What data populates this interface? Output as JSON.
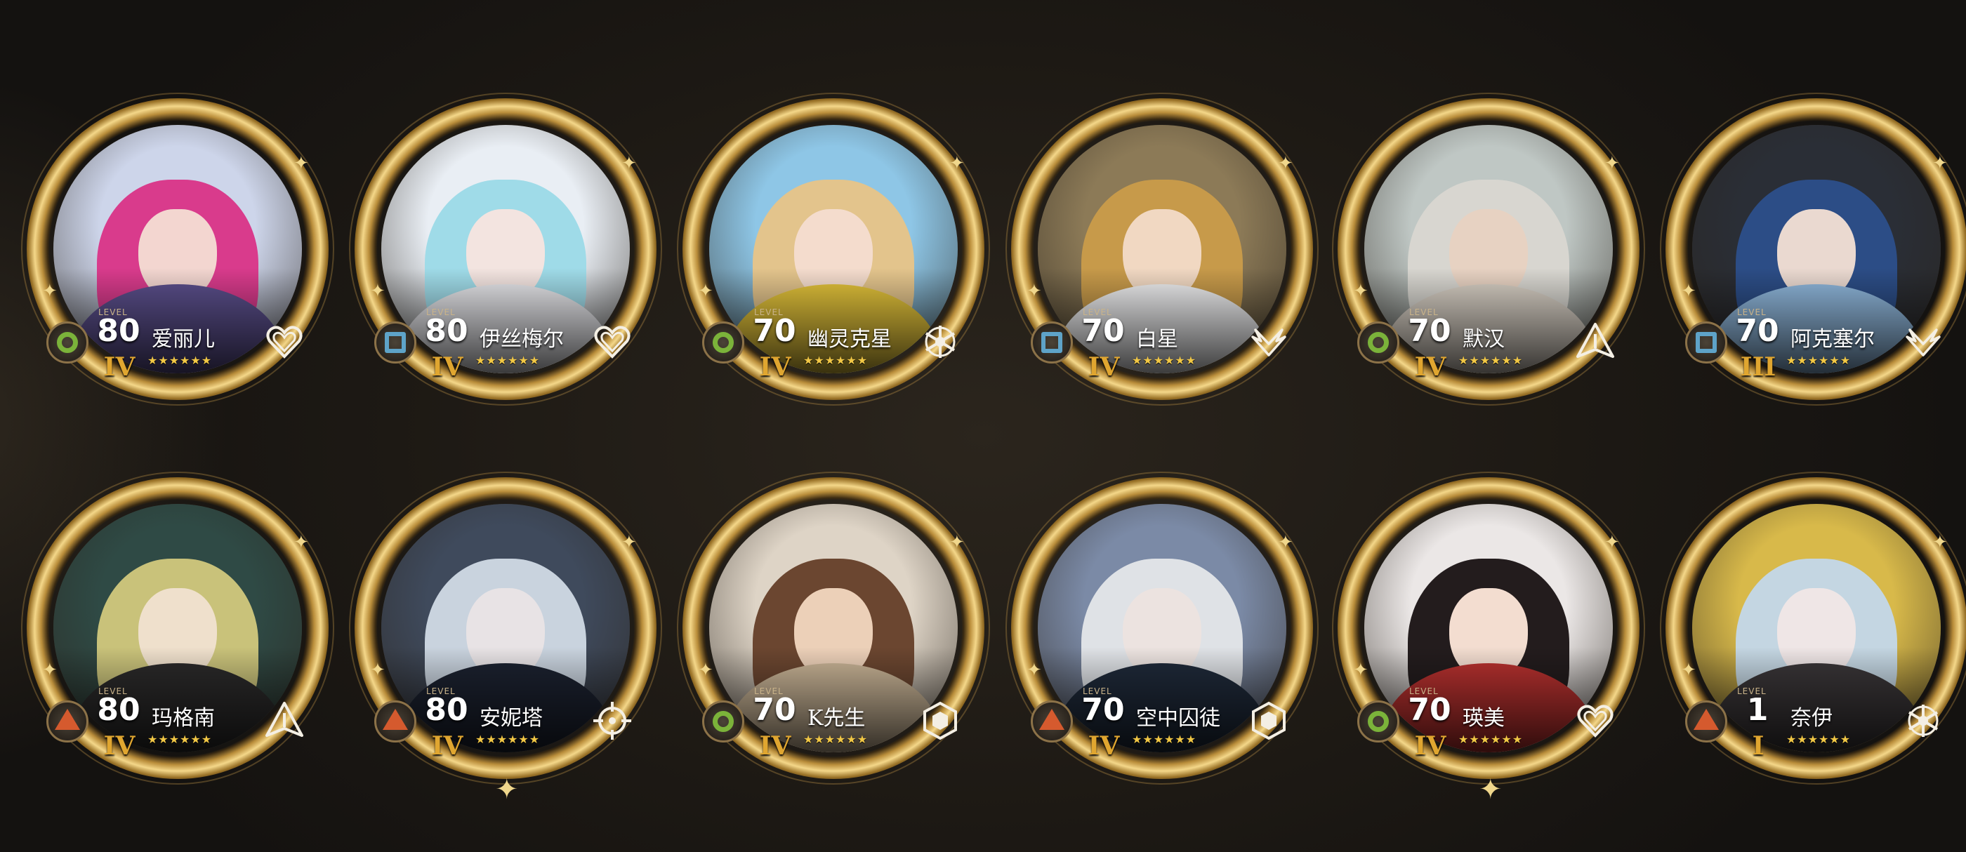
{
  "level_tag": "LEVEL",
  "colors": {
    "ring_gold": "#f4d789",
    "rank_gold": "#e0a630",
    "star_yellow": "#f2c846",
    "class_green": "#7bb33a",
    "class_blue": "#5ea3c8",
    "class_red": "#d55a2e"
  },
  "characters": [
    {
      "name": "爱丽儿",
      "level": "80",
      "rank": "IV",
      "stars": "★★★★★★",
      "class_icon": "green-circle-icon",
      "role_icon": "heart-emblem-icon",
      "hair": "#d93b8c",
      "skin": "#f3d6d0",
      "outfit": "#5b4f8c",
      "bg": "#cdd5ea"
    },
    {
      "name": "伊丝梅尔",
      "level": "80",
      "rank": "IV",
      "stars": "★★★★★★",
      "class_icon": "blue-square-icon",
      "role_icon": "heart-emblem-icon",
      "hair": "#9fdbe8",
      "skin": "#f3e4e0",
      "outfit": "#e6e6ea",
      "bg": "#e9eef4"
    },
    {
      "name": "幽灵克星",
      "level": "70",
      "rank": "IV",
      "stars": "★★★★★★",
      "class_icon": "green-circle-icon",
      "role_icon": "snowflake-emblem-icon",
      "hair": "#e3c48c",
      "skin": "#f4dccd",
      "outfit": "#e3c33a",
      "bg": "#8ec6e6"
    },
    {
      "name": "白星",
      "level": "70",
      "rank": "IV",
      "stars": "★★★★★★",
      "class_icon": "blue-square-icon",
      "role_icon": "wings-emblem-icon",
      "hair": "#c79a4a",
      "skin": "#f1d8c2",
      "outfit": "#efeff0",
      "bg": "#8c7a57"
    },
    {
      "name": "默汉",
      "level": "70",
      "rank": "IV",
      "stars": "★★★★★★",
      "class_icon": "green-circle-icon",
      "role_icon": "arrowhead-emblem-icon",
      "hair": "#d8d6d0",
      "skin": "#e7d2c2",
      "outfit": "#d7cfc4",
      "bg": "#bfc7c4"
    },
    {
      "name": "阿克塞尔",
      "level": "70",
      "rank": "III",
      "stars": "★★★★★★",
      "class_icon": "blue-square-icon",
      "role_icon": "wings-emblem-icon",
      "hair": "#2c4d86",
      "skin": "#ead9d0",
      "outfit": "#8fb7dc",
      "bg": "#2a2e36"
    },
    {
      "name": "玛格南",
      "level": "80",
      "rank": "IV",
      "stars": "★★★★★★",
      "class_icon": "red-triangle-icon",
      "role_icon": "arrowhead-emblem-icon",
      "hair": "#c9c27a",
      "skin": "#efe0cc",
      "outfit": "#2b2a2a",
      "bg": "#2f4a45"
    },
    {
      "name": "安妮塔",
      "level": "80",
      "rank": "IV",
      "stars": "★★★★★★",
      "class_icon": "red-triangle-icon",
      "role_icon": "crosshair-emblem-icon",
      "hair": "#c9d3de",
      "skin": "#e8e3e5",
      "outfit": "#1c2230",
      "bg": "#3f4a5c"
    },
    {
      "name": "K先生",
      "level": "70",
      "rank": "IV",
      "stars": "★★★★★★",
      "class_icon": "green-circle-icon",
      "role_icon": "hexagon-emblem-icon",
      "hair": "#6b4630",
      "skin": "#ecd0b8",
      "outfit": "#c9b496",
      "bg": "#ded4c6"
    },
    {
      "name": "空中囚徒",
      "level": "70",
      "rank": "IV",
      "stars": "★★★★★★",
      "class_icon": "red-triangle-icon",
      "role_icon": "hexagon-emblem-icon",
      "hair": "#dfe2e6",
      "skin": "#ece3e0",
      "outfit": "#1f2a3a",
      "bg": "#7b8aa6"
    },
    {
      "name": "瑛美",
      "level": "70",
      "rank": "IV",
      "stars": "★★★★★★",
      "class_icon": "green-circle-icon",
      "role_icon": "heart-emblem-icon",
      "hair": "#231c1d",
      "skin": "#f3ddd0",
      "outfit": "#b8312f",
      "bg": "#ebe7e6"
    },
    {
      "name": "奈伊",
      "level": "1",
      "rank": "I",
      "stars": "★★★★★★",
      "class_icon": "red-triangle-icon",
      "role_icon": "snowflake-emblem-icon",
      "hair": "#c4d6e2",
      "skin": "#efe6e6",
      "outfit": "#3a3638",
      "bg": "#d8b94a"
    }
  ]
}
